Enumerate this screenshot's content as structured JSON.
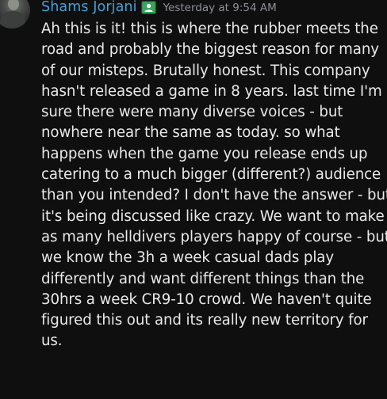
{
  "message": {
    "author": "Shams Jorjani",
    "timestamp": "Yesterday at 9:54 AM",
    "author_color": "#44a0d8",
    "role_icon": "user-badge-icon",
    "role_icon_color": "#3aa55d",
    "lines": [
      "Ah this is it! this is where the rubber meets the",
      "road and probably the biggest reason for many",
      "of our misteps. Brutally honest. This company",
      "hasn't released a game in 8 years. last time I'm",
      "sure there were many diverse voices - but",
      "nowhere near the same as today. so what",
      "happens when the game you release ends up",
      "catering to a much bigger (different?) audience",
      "than you intended? I don't have the answer - but",
      "it's being discussed like crazy. We want to make",
      "as many helldivers players happy of course - but",
      "we know the 3h a week casual dads play",
      "differently and want different things than the",
      "30hrs a week CR9-10 crowd. We haven't quite",
      "figured this out and its really new territory for",
      "us."
    ]
  }
}
